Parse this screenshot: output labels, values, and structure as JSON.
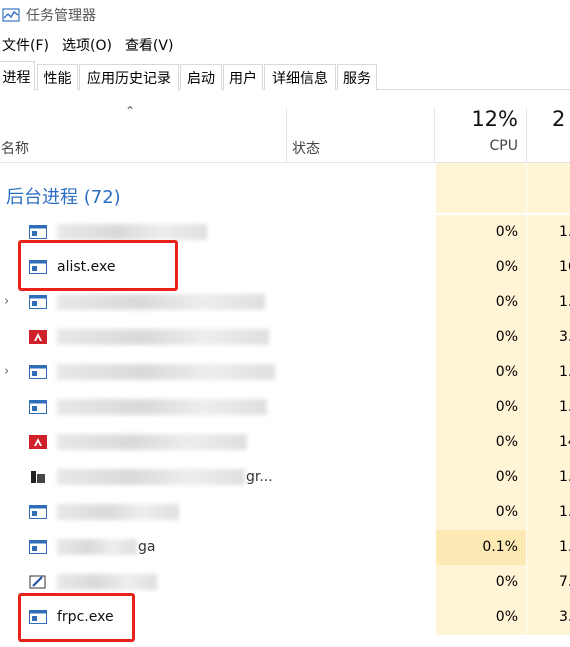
{
  "window": {
    "title": "任务管理器"
  },
  "menu": [
    "文件(F)",
    "选项(O)",
    "查看(V)"
  ],
  "tabs": [
    "进程",
    "性能",
    "应用历史记录",
    "启动",
    "用户",
    "详细信息",
    "服务"
  ],
  "columns": {
    "name": "名称",
    "status": "状态",
    "cpu_percent": "12%",
    "cpu_label": "CPU",
    "memory_percent_partial": "2"
  },
  "group": {
    "label": "后台进程 (72)"
  },
  "processes": [
    {
      "name": "",
      "name_fragment": "",
      "cpu": "0%",
      "memory": "1.",
      "expandable": false,
      "icon": "window-icon"
    },
    {
      "name": "alist.exe",
      "name_fragment": "",
      "cpu": "0%",
      "memory": "16.",
      "expandable": false,
      "icon": "window-icon",
      "highlighted": true
    },
    {
      "name": "",
      "name_fragment": "",
      "cpu": "0%",
      "memory": "1.",
      "expandable": true,
      "icon": "window-icon"
    },
    {
      "name": "",
      "name_fragment": "",
      "cpu": "0%",
      "memory": "3.",
      "expandable": false,
      "icon": "amd-icon"
    },
    {
      "name": "",
      "name_fragment": "",
      "cpu": "0%",
      "memory": "1.",
      "expandable": true,
      "icon": "window-icon"
    },
    {
      "name": "",
      "name_fragment": "",
      "cpu": "0%",
      "memory": "1.",
      "expandable": false,
      "icon": "window-icon"
    },
    {
      "name": "",
      "name_fragment": "",
      "cpu": "0%",
      "memory": "14.",
      "expandable": false,
      "icon": "amd-icon"
    },
    {
      "name": "",
      "name_fragment": "gr...",
      "cpu": "0%",
      "memory": "1.",
      "expandable": false,
      "icon": "app-icon"
    },
    {
      "name": "",
      "name_fragment": "",
      "cpu": "0%",
      "memory": "1.",
      "expandable": false,
      "icon": "window-icon"
    },
    {
      "name": "",
      "name_fragment": "ga",
      "cpu": "0.1%",
      "memory": "1.",
      "expandable": false,
      "icon": "window-icon"
    },
    {
      "name": "",
      "name_fragment": "",
      "cpu": "0%",
      "memory": "7.",
      "expandable": false,
      "icon": "edit-icon"
    },
    {
      "name": "frpc.exe",
      "name_fragment": "",
      "cpu": "0%",
      "memory": "3.",
      "expandable": false,
      "icon": "window-icon",
      "highlighted": true
    }
  ],
  "colors": {
    "group_label": "#2b6fc4",
    "cpu_heat": "#fff4d6",
    "cpu_heat_active": "#fce9b4",
    "annotation": "#e8221a"
  }
}
